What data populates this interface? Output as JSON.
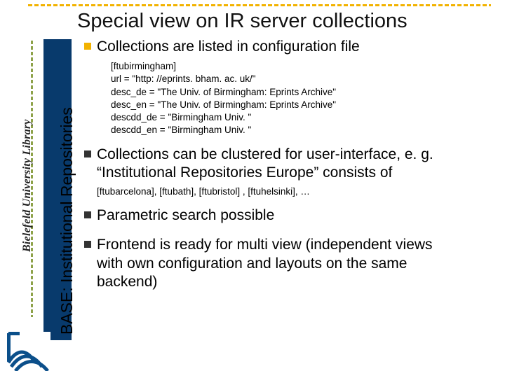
{
  "title": "Special view on IR server collections",
  "brand": "Bielefeld University Library",
  "sidebar_label": "BASE: Institutional Repositories",
  "bullets": {
    "b1": "Collections are listed in configuration file",
    "b2_a": "Collections can be clustered for user-interface, e. g.",
    "b2_b": "“Institutional Repositories Europe” consists of",
    "b3": "Parametric search possible",
    "b4_a": "Frontend is ready for multi view (independent views",
    "b4_b": "with own configuration and layouts on the same",
    "b4_c": "backend)"
  },
  "config_block": "[ftubirmingham]\nurl = \"http: //eprints. bham. ac. uk/\"\ndesc_de = \"The Univ. of Birmingham: Eprints Archive\"\ndesc_en = \"The Univ. of Birmingham: Eprints Archive\"\ndescdd_de = \"Birmingham Univ. \"\ndescdd_en = \"Birmingham Univ. \"",
  "cluster_example": "[ftubarcelona], [ftubath], [ftubristol] , [ftuhelsinki], …"
}
